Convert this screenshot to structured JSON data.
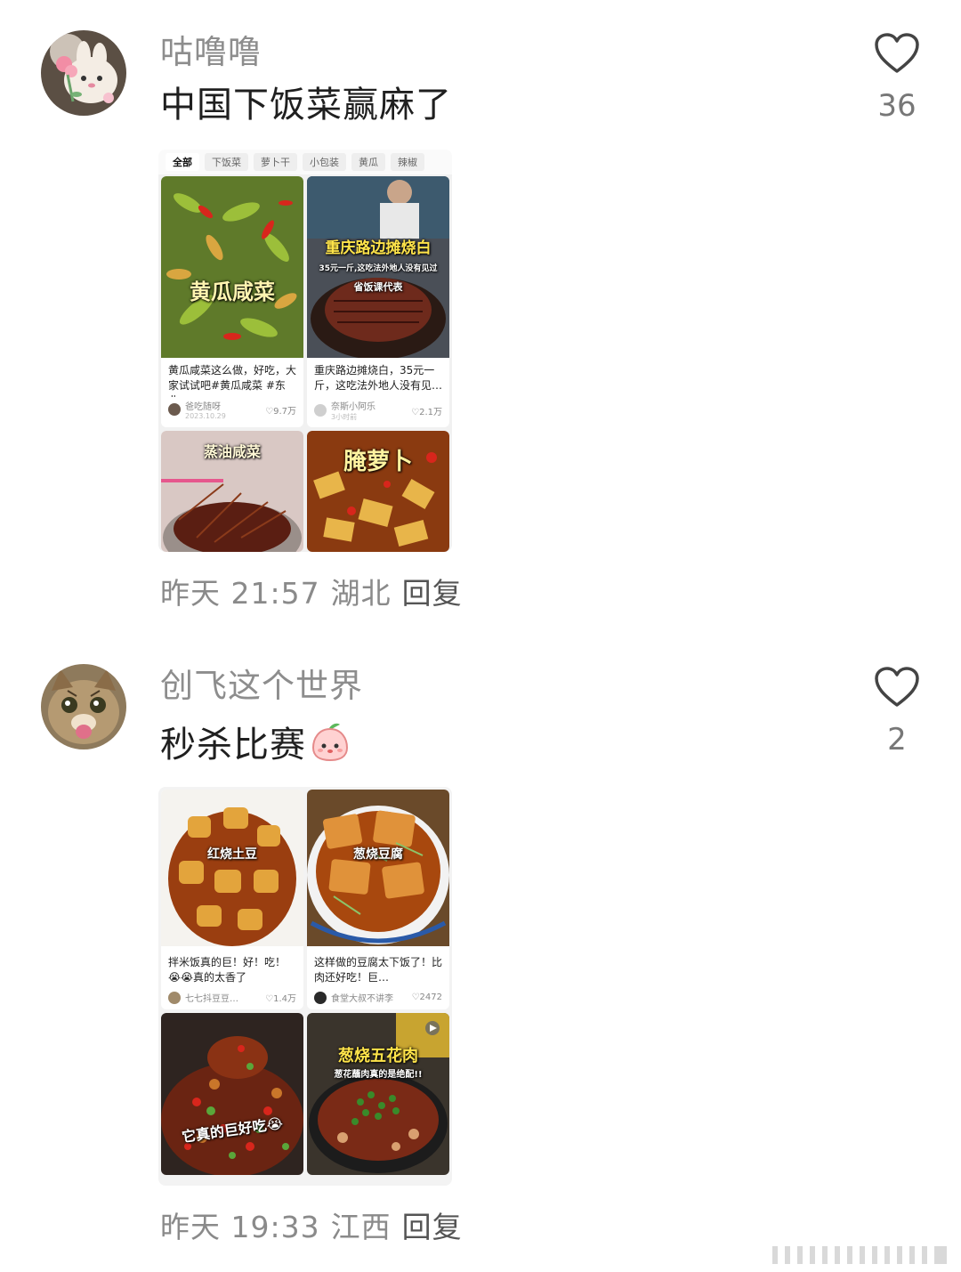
{
  "comments": [
    {
      "username": "咕噜噜",
      "text": "中国下饭菜赢麻了",
      "likes": "36",
      "time": "昨天 21:57",
      "location": "湖北",
      "reply_label": "回复",
      "screenshot": {
        "filters": [
          "全部",
          "下饭菜",
          "萝卜干",
          "小包装",
          "黄瓜",
          "辣椒"
        ],
        "cards": [
          {
            "image_title": "黄瓜咸菜",
            "desc": "黄瓜咸菜这么做，好吃，大家试试吧#黄瓜咸菜 #东北…",
            "author": "爸吃随呀",
            "date": "2023.10.29",
            "likes": "♡9.7万"
          },
          {
            "image_title": "重庆路边摊烧白",
            "image_subtitle": "35元一斤,这吃法外地人没有见过",
            "image_tag": "省饭课代表",
            "desc": "重庆路边摊烧白，35元一斤，这吃法外地人没有见…",
            "author": "奈斯小阿乐",
            "date": "3小时前",
            "likes": "♡2.1万"
          },
          {
            "image_title": "蒸油咸菜"
          },
          {
            "image_title": "腌萝卜"
          }
        ]
      }
    },
    {
      "username": "创飞这个世界",
      "text": "秒杀比赛",
      "likes": "2",
      "time": "昨天 19:33",
      "location": "江西",
      "reply_label": "回复",
      "screenshot": {
        "cards": [
          {
            "image_title": "红烧土豆",
            "desc": "拌米饭真的巨！好！吃！😭😭真的太香了",
            "author": "七七抖豆豆…",
            "likes": "♡1.4万"
          },
          {
            "image_title": "葱烧豆腐",
            "desc": "这样做的豆腐太下饭了！比肉还好吃！巨…",
            "author": "食堂大叔不讲李",
            "likes": "♡2472"
          },
          {
            "image_title": "它真的巨好吃😭"
          },
          {
            "image_title": "葱烧五花肉",
            "image_subtitle": "葱花蘸肉真的是绝配!!"
          }
        ]
      }
    }
  ],
  "colors": {
    "username": "#8d8d8d",
    "meta": "#8a8a8a",
    "heart_stroke": "#444444"
  }
}
